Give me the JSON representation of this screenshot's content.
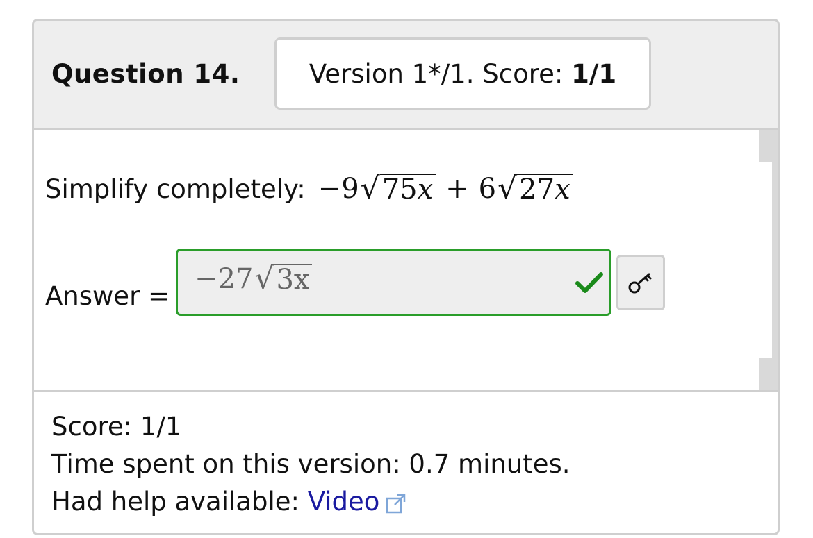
{
  "header": {
    "question_label": "Question 14.",
    "version_text": "Version 1*/1. Score: ",
    "version_score": "1/1"
  },
  "problem": {
    "prompt": "Simplify completely:",
    "expr": {
      "t1_sign": "−9",
      "t1_radicand_num": "75",
      "t1_radicand_var": "x",
      "operator": "+",
      "t2_coef": "6",
      "t2_radicand_num": "27",
      "t2_radicand_var": "x"
    }
  },
  "answer": {
    "label": "Answer =",
    "coef": "−27",
    "radicand_num": "3",
    "radicand_var": "x",
    "status": "correct",
    "status_color": "#1a8a1a",
    "key_icon": "key-icon"
  },
  "footer": {
    "score_line": "Score: 1/1",
    "time_line": "Time spent on this version: 0.7 minutes.",
    "help_label": "Had help available: ",
    "help_link": "Video",
    "link_icon": "external-link-icon"
  }
}
